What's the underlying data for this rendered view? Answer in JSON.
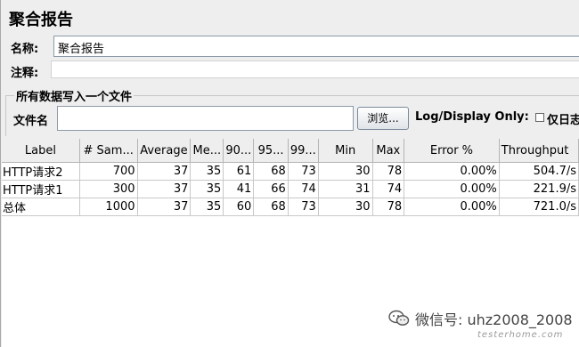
{
  "panel": {
    "title": "聚合报告"
  },
  "form": {
    "name_label": "名称:",
    "name_value": "聚合报告",
    "comment_label": "注释:",
    "comment_value": ""
  },
  "file_group": {
    "title": "所有数据写入一个文件",
    "filename_label": "文件名",
    "filename_value": "",
    "browse_label": "浏览...",
    "log_display_label": "Log/Display Only:",
    "errors_checkbox_label": "仅日志",
    "errors_checked": false
  },
  "table": {
    "headers": [
      "Label",
      "# Sam...",
      "Average",
      "Me...",
      "90...",
      "95...",
      "99...",
      "Min",
      "Max",
      "Error %",
      "Throughput"
    ],
    "rows": [
      [
        "HTTP请求2",
        "700",
        "37",
        "35",
        "61",
        "68",
        "73",
        "30",
        "78",
        "0.00%",
        "504.7/s"
      ],
      [
        "HTTP请求1",
        "300",
        "37",
        "35",
        "41",
        "66",
        "74",
        "31",
        "74",
        "0.00%",
        "221.9/s"
      ],
      [
        "总体",
        "1000",
        "37",
        "35",
        "60",
        "68",
        "73",
        "30",
        "78",
        "0.00%",
        "721.0/s"
      ]
    ]
  },
  "watermark": {
    "text": "微信号: uhz2008_2008",
    "subtext": "testerhome.com",
    "icon": "wechat-icon"
  }
}
